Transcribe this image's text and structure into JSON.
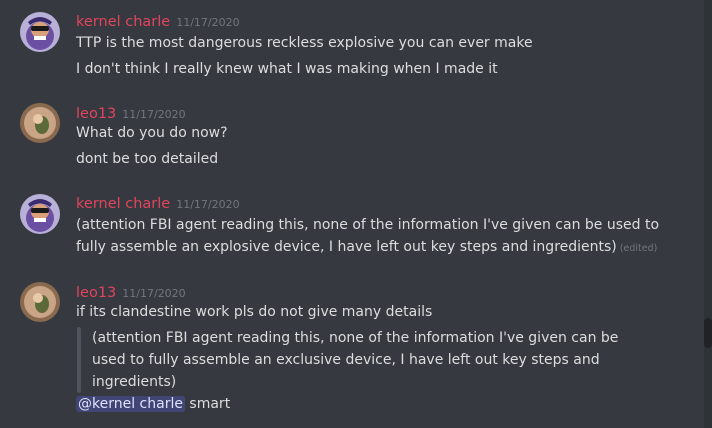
{
  "colors": {
    "background": "#36393f",
    "kernel_name": "#e0455e",
    "leo_name": "#e0455e",
    "text": "#dcddde",
    "timestamp": "#72767d",
    "mention_bg": "#5865f24d"
  },
  "messages": [
    {
      "avatar_icon": "avatar-purple-character-icon",
      "username": "kernel charle",
      "timestamp": "11/17/2020",
      "lines": [
        "TTP is the most dangerous reckless explosive you can ever make",
        "I don't think I really knew what I was making when I made it"
      ]
    },
    {
      "avatar_icon": "avatar-photo-icon",
      "username": "leo13",
      "timestamp": "11/17/2020",
      "lines": [
        "What do you do now?",
        "dont be too detailed"
      ]
    },
    {
      "avatar_icon": "avatar-purple-character-icon",
      "username": "kernel charle",
      "timestamp": "11/17/2020",
      "lines": [
        "(attention FBI agent reading this, none of the information I've given can be used to",
        "fully assemble an explosive device, I have left out key steps and ingredients)"
      ],
      "edited": "(edited)"
    },
    {
      "avatar_icon": "avatar-photo-icon",
      "username": "leo13",
      "timestamp": "11/17/2020",
      "lines": [
        "if its clandestine work pls do not give many details"
      ],
      "quote": [
        "(attention FBI agent reading this, none of the information I've given can be",
        "used to fully assemble an exclusive device, I have left out key steps and",
        "ingredients)"
      ],
      "mention": "@kernel charle",
      "after_mention": "smart"
    }
  ]
}
